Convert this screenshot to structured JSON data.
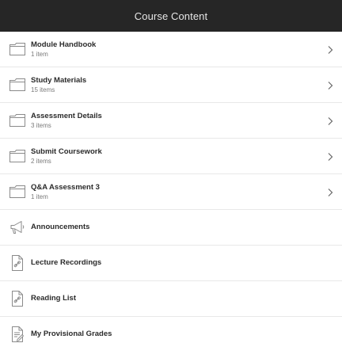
{
  "header": {
    "title": "Course Content"
  },
  "items": [
    {
      "title": "Module Handbook",
      "subtitle": "1 item",
      "icon": "folder-icon"
    },
    {
      "title": "Study Materials",
      "subtitle": "15 items",
      "icon": "folder-icon"
    },
    {
      "title": "Assessment Details",
      "subtitle": "3 items",
      "icon": "folder-icon"
    },
    {
      "title": "Submit Coursework",
      "subtitle": "2 items",
      "icon": "folder-icon"
    },
    {
      "title": "Q&A Assessment 3",
      "subtitle": "1 item",
      "icon": "folder-icon"
    },
    {
      "title": "Announcements",
      "icon": "megaphone-icon"
    },
    {
      "title": "Lecture Recordings",
      "icon": "link-document-icon"
    },
    {
      "title": "Reading List",
      "icon": "link-document-icon"
    },
    {
      "title": "My Provisional Grades",
      "icon": "grades-document-icon"
    }
  ],
  "colors": {
    "header_background": "#262626",
    "header_text": "#e6e6e6",
    "title_text": "#2b2b2b",
    "subtitle_text": "#7a7a7a",
    "divider": "#e8e8e8"
  }
}
